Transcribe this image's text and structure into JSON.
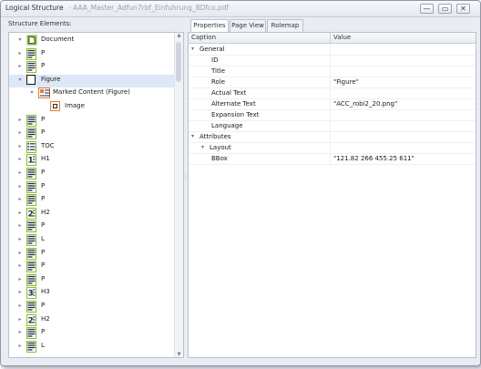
{
  "window": {
    "title": "Logical Structure",
    "title_suffix": " - AAA_Master_Adfun7rbf_Einfuhrung_8Dfco.pdf",
    "buttons": {
      "minimize": "—",
      "restore": "▭",
      "close": "✕"
    }
  },
  "left": {
    "label": "Structure Elements:",
    "tree": [
      {
        "label": "Document",
        "icon": "document-icon",
        "expander": "▾"
      },
      {
        "label": "P",
        "icon": "paragraph-icon",
        "expander": "▸"
      },
      {
        "label": "P",
        "icon": "paragraph-icon",
        "expander": "▸"
      },
      {
        "label": "Figure",
        "icon": "figure-icon",
        "expander": "▾",
        "selected": true
      },
      {
        "label": "Marked Content (Figure)",
        "icon": "marked-content-icon",
        "expander": "▾"
      },
      {
        "label": "Image",
        "icon": "image-icon",
        "expander": ""
      },
      {
        "label": "P",
        "icon": "paragraph-icon",
        "expander": "▸"
      },
      {
        "label": "P",
        "icon": "paragraph-icon",
        "expander": "▸"
      },
      {
        "label": "TOC",
        "icon": "toc-icon",
        "expander": "▸"
      },
      {
        "label": "H1",
        "icon": "heading-1-icon",
        "expander": "▸"
      },
      {
        "label": "P",
        "icon": "paragraph-icon",
        "expander": "▸"
      },
      {
        "label": "P",
        "icon": "paragraph-icon",
        "expander": "▸"
      },
      {
        "label": "P",
        "icon": "paragraph-icon",
        "expander": "▸"
      },
      {
        "label": "H2",
        "icon": "heading-2-icon",
        "expander": "▸"
      },
      {
        "label": "P",
        "icon": "paragraph-icon",
        "expander": "▸"
      },
      {
        "label": "L",
        "icon": "list-icon",
        "expander": "▸"
      },
      {
        "label": "P",
        "icon": "paragraph-icon",
        "expander": "▸"
      },
      {
        "label": "P",
        "icon": "paragraph-icon",
        "expander": "▸"
      },
      {
        "label": "P",
        "icon": "paragraph-icon",
        "expander": "▸"
      },
      {
        "label": "H3",
        "icon": "heading-3-icon",
        "expander": "▸"
      },
      {
        "label": "P",
        "icon": "paragraph-icon",
        "expander": "▸"
      },
      {
        "label": "H2",
        "icon": "heading-2-icon",
        "expander": "▸"
      },
      {
        "label": "P",
        "icon": "paragraph-icon",
        "expander": "▸"
      },
      {
        "label": "L",
        "icon": "list-icon",
        "expander": "▸"
      }
    ]
  },
  "tabs": [
    "Properties",
    "Page View",
    "Rolemap"
  ],
  "grid": {
    "headers": {
      "caption": "Caption",
      "value": "Value"
    },
    "rows": [
      {
        "caption": "General",
        "value": "",
        "toggle": "▾"
      },
      {
        "caption": "ID",
        "value": ""
      },
      {
        "caption": "Title",
        "value": ""
      },
      {
        "caption": "Role",
        "value": "\"Figure\""
      },
      {
        "caption": "Actual Text",
        "value": ""
      },
      {
        "caption": "Alternate Text",
        "value": "\"ACC_robi2_20.png\""
      },
      {
        "caption": "Expansion Text",
        "value": ""
      },
      {
        "caption": "Language",
        "value": ""
      },
      {
        "caption": "Attributes",
        "value": "",
        "toggle": "▾"
      },
      {
        "caption": "Layout",
        "value": "",
        "toggle": "▾"
      },
      {
        "caption": "BBox",
        "value": "\"121.82 266 455.25 611\""
      }
    ]
  },
  "colors": {
    "tag_green": "#8cbb2b",
    "image_orange": "#e07b3a",
    "selection": "#dce8f6"
  }
}
